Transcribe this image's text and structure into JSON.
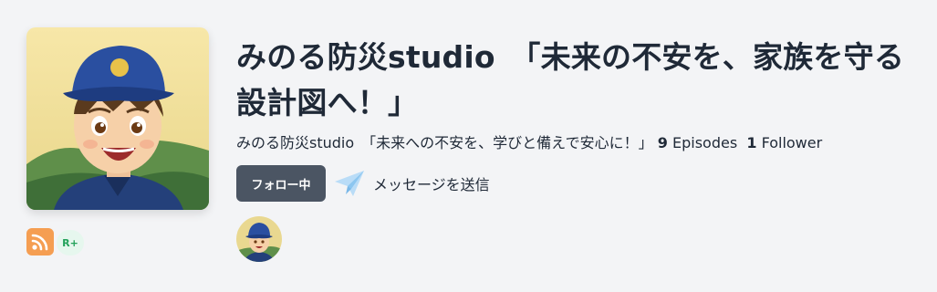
{
  "podcast": {
    "title": "みのる防災studio　「未来の不安を、家族を守る設計図へ！」",
    "author": "みのる防災studio　「未来への不安を、学びと備えで安心に！」",
    "episodes_count": "9",
    "episodes_label": "Episodes",
    "followers_count": "1",
    "followers_label": "Follower"
  },
  "actions": {
    "follow_label": "フォロー中",
    "message_label": "メッセージを送信"
  },
  "badges": {
    "rplus_label": "R+"
  },
  "icons": {
    "rss": "rss-icon",
    "send": "paper-plane-icon"
  },
  "colors": {
    "background": "#f3f4f6",
    "follow_button": "#4b5563",
    "rss": "#f59e52",
    "rplus_text": "#22a15a",
    "send_icon": "#93c5fd"
  }
}
